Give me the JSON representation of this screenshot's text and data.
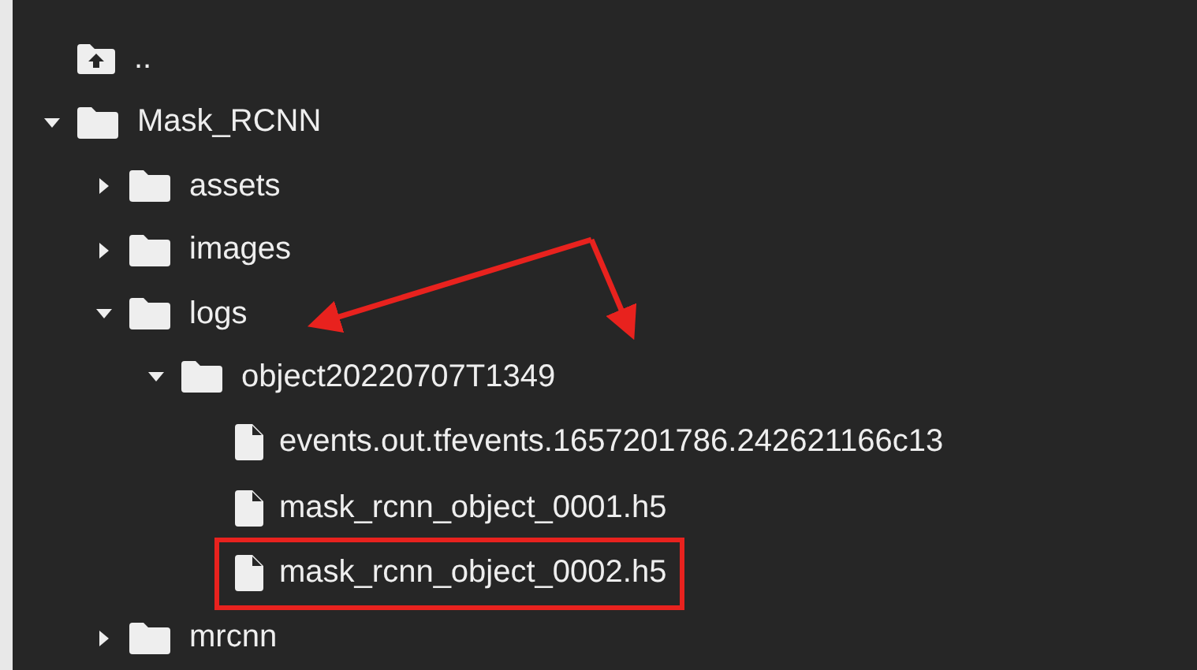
{
  "tree": [
    {
      "kind": "up",
      "label": ".."
    },
    {
      "kind": "folder",
      "label": "Mask_RCNN",
      "expanded": true,
      "children": [
        {
          "kind": "folder",
          "label": "assets",
          "expanded": false
        },
        {
          "kind": "folder",
          "label": "images",
          "expanded": false
        },
        {
          "kind": "folder",
          "label": "logs",
          "expanded": true,
          "children": [
            {
              "kind": "folder",
              "label": "object20220707T1349",
              "expanded": true,
              "children": [
                {
                  "kind": "file",
                  "label": "events.out.tfevents.1657201786.242621166c13",
                  "highlighted": false
                },
                {
                  "kind": "file",
                  "label": "mask_rcnn_object_0001.h5",
                  "highlighted": false
                },
                {
                  "kind": "file",
                  "label": "mask_rcnn_object_0002.h5",
                  "highlighted": true
                }
              ]
            }
          ]
        },
        {
          "kind": "folder",
          "label": "mrcnn",
          "expanded": false
        }
      ]
    }
  ]
}
